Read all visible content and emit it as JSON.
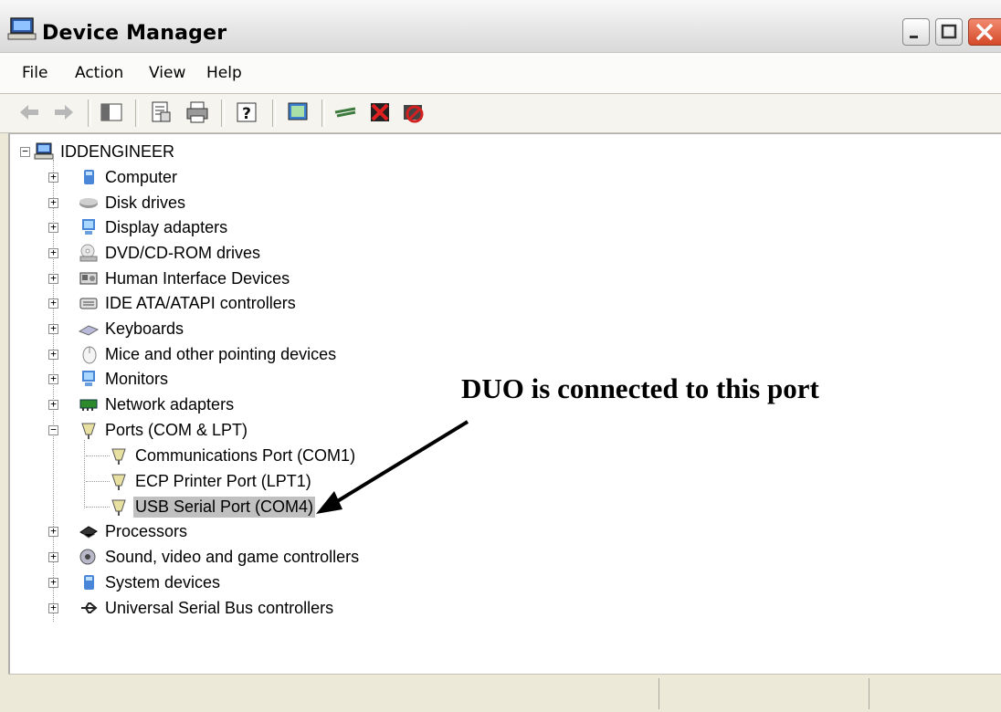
{
  "window": {
    "title": "Device Manager",
    "icon": "computer-icon"
  },
  "menu": [
    "File",
    "Action",
    "View",
    "Help"
  ],
  "toolbar": {
    "buttons": [
      "back-arrow-icon",
      "forward-arrow-icon",
      "show-hide-console-tree-icon",
      "properties-icon",
      "print-icon",
      "help-icon",
      "scan-hardware-icon",
      "update-driver-icon",
      "uninstall-icon",
      "disable-device-icon"
    ]
  },
  "tree": {
    "root": "IDDENGINEER",
    "categories": [
      {
        "label": "Computer",
        "icon": "computer-icon"
      },
      {
        "label": "Disk drives",
        "icon": "disk-drive-icon"
      },
      {
        "label": "Display adapters",
        "icon": "monitor-icon"
      },
      {
        "label": "DVD/CD-ROM drives",
        "icon": "dvd-icon"
      },
      {
        "label": "Human Interface Devices",
        "icon": "hid-icon"
      },
      {
        "label": "IDE ATA/ATAPI controllers",
        "icon": "ide-controller-icon"
      },
      {
        "label": "Keyboards",
        "icon": "keyboard-icon"
      },
      {
        "label": "Mice and other pointing devices",
        "icon": "mouse-icon"
      },
      {
        "label": "Monitors",
        "icon": "monitor-icon"
      },
      {
        "label": "Network adapters",
        "icon": "network-adapter-icon"
      },
      {
        "label": "Ports (COM & LPT)",
        "icon": "port-icon",
        "expanded": true,
        "children": [
          {
            "label": "Communications Port (COM1)",
            "icon": "port-icon"
          },
          {
            "label": "ECP Printer Port (LPT1)",
            "icon": "port-icon"
          },
          {
            "label": "USB Serial Port (COM4)",
            "icon": "port-icon",
            "selected": true
          }
        ]
      },
      {
        "label": "Processors",
        "icon": "processor-icon"
      },
      {
        "label": "Sound, video and game controllers",
        "icon": "sound-icon"
      },
      {
        "label": "System devices",
        "icon": "computer-icon"
      },
      {
        "label": "Universal Serial Bus controllers",
        "icon": "usb-icon"
      }
    ]
  },
  "annotation": {
    "text": "DUO is connected to this port"
  }
}
